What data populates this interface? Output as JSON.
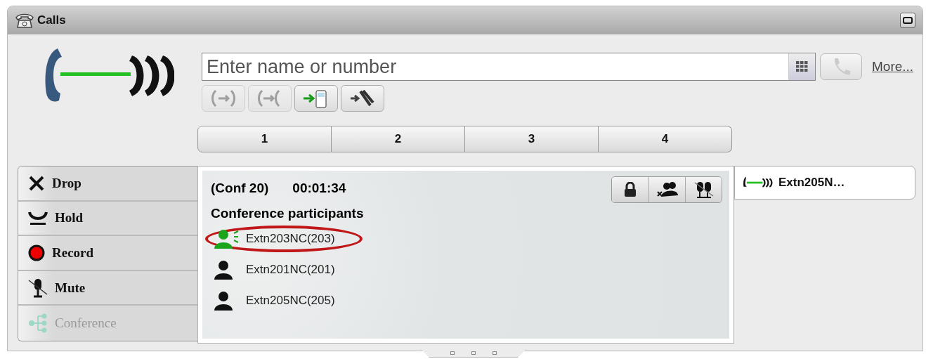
{
  "window": {
    "title": "Calls"
  },
  "dial": {
    "placeholder": "Enter name or number",
    "more_link": "More..."
  },
  "tool_buttons": [
    {
      "kind": "transfer",
      "disabled": true
    },
    {
      "kind": "swap",
      "disabled": true
    },
    {
      "kind": "mobile",
      "disabled": false
    },
    {
      "kind": "park",
      "disabled": false
    }
  ],
  "tabs": [
    {
      "label": "1",
      "selected": false
    },
    {
      "label": "2",
      "selected": false
    },
    {
      "label": "3",
      "selected": false
    },
    {
      "label": "4",
      "selected": false
    }
  ],
  "actions": [
    {
      "kind": "drop",
      "label": "Drop",
      "disabled": false
    },
    {
      "kind": "hold",
      "label": "Hold",
      "disabled": false
    },
    {
      "kind": "record",
      "label": "Record",
      "disabled": false
    },
    {
      "kind": "mute",
      "label": "Mute",
      "disabled": false
    },
    {
      "kind": "conference",
      "label": "Conference",
      "disabled": true
    }
  ],
  "conference": {
    "name": "(Conf 20)",
    "duration": "00:01:34",
    "heading": "Conference participants",
    "participants": [
      {
        "name": "Extn203NC(203)",
        "talking": true,
        "highlighted": true
      },
      {
        "name": "Extn201NC(201)",
        "talking": false,
        "highlighted": false
      },
      {
        "name": "Extn205NC(205)",
        "talking": false,
        "highlighted": false
      }
    ]
  },
  "calls": [
    {
      "label": "Extn205N…"
    }
  ]
}
